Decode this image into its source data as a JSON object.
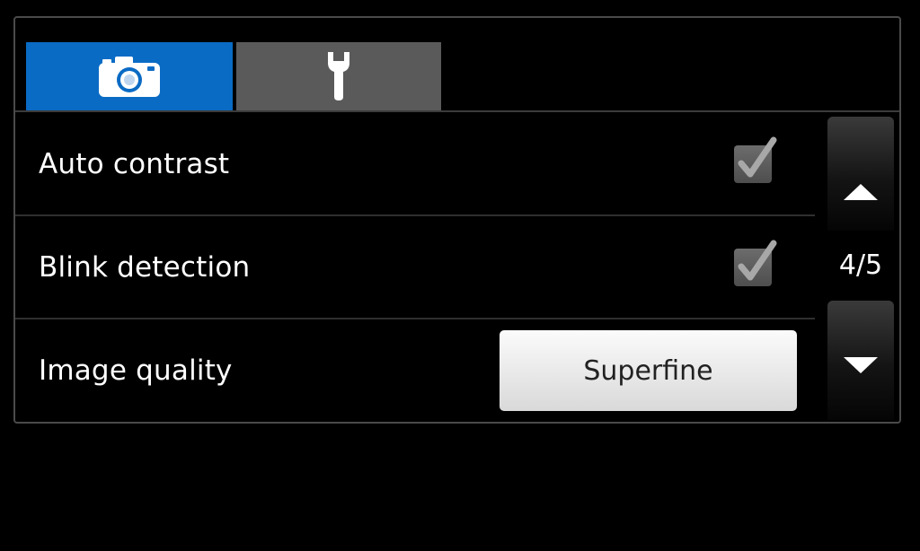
{
  "tabs": [
    {
      "name": "camera",
      "icon": "camera-icon",
      "selected": true,
      "color": "#0a6bc4"
    },
    {
      "name": "settings",
      "icon": "wrench-icon",
      "selected": false,
      "color": "#5a5a5a"
    }
  ],
  "settings": [
    {
      "label": "Auto contrast",
      "type": "checkbox",
      "checked": true
    },
    {
      "label": "Blink detection",
      "type": "checkbox",
      "checked": true
    },
    {
      "label": "Image quality",
      "type": "select",
      "value": "Superfine"
    }
  ],
  "pager": {
    "indicator": "4/5",
    "up_icon": "arrow-up-icon",
    "down_icon": "arrow-down-icon"
  }
}
